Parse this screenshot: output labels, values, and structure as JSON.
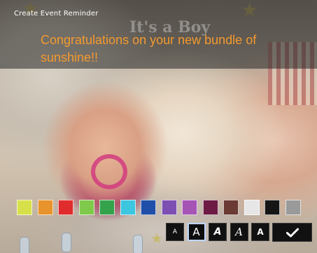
{
  "window": {
    "title": "Create Event Reminder"
  },
  "photo": {
    "banner_text": "It's a Boy"
  },
  "message": {
    "text": "Congratulations on your new bundle of sunshine!!",
    "color": "#f39a2e"
  },
  "palette": {
    "colors": [
      "#d7e04a",
      "#e8932b",
      "#e02c2c",
      "#7fc94b",
      "#34a24a",
      "#3cc6e0",
      "#1f4fa8",
      "#7e4fb3",
      "#a653b6",
      "#6d1b45",
      "#6a3a33",
      "#e6e6e6",
      "#151515",
      "#9a9a9a"
    ]
  },
  "font_styles": {
    "selected_index": 1,
    "buttons": [
      {
        "label": "A",
        "style": "small"
      },
      {
        "label": "A",
        "style": "regular"
      },
      {
        "label": "A",
        "style": "italic"
      },
      {
        "label": "A",
        "style": "script"
      },
      {
        "label": "A",
        "style": "bold"
      }
    ]
  },
  "confirm": {
    "icon": "checkmark-icon"
  }
}
